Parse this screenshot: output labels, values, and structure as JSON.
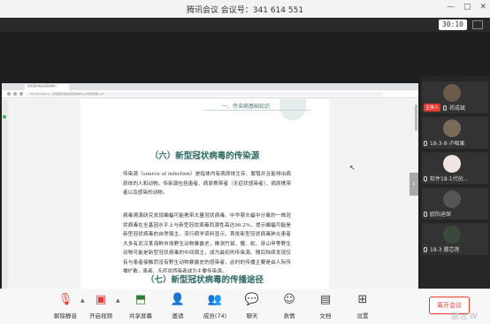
{
  "titlebar": {
    "title": "腾讯会议 会议号：341 614 551"
  },
  "status": {
    "timer": "30:10"
  },
  "browser": {
    "tab_label": "新型冠状病毒感染的肺炎",
    "url": "file:///C:/Users/.../新型冠状病毒感染的肺炎公众防护指南.pdf"
  },
  "document": {
    "page_header": "一、传染病基础知识",
    "section6_title": "（六）新型冠状病毒的传染源",
    "para1": "传染源（source of infection）是指体内有病原体生存、繁殖并且能排出病原体的人和动物。传染源包括患者、病原携带者（无症状感染者）、病原携带者以及感染的动物。",
    "para2": "病毒溯源研究发现蝙蝠可能携带大量冠状病毒。中华菊头蝠中分离的一株冠状病毒在全基因水平上与新型冠状病毒同源性高达96.2%，提示蝙蝠可能是新型冠状病毒的自然宿主。流行病学资料显示，首批新型冠状病毒肺炎患者大多有武汉某海鲜市场野生动物暴露史，推测竹鼠、獾、蛇、穿山甲等野生动物可能是新型冠状病毒的中间宿主，成为最初的传染源。随后陆续发现仅有与患者接触而没有野生动物暴露史的感染者，此时的传播主要是由人际传播扩散，患者、无症状感染者成为主要传染源。",
    "section7_title": "（七）新型冠状病毒的传播途径"
  },
  "participants": [
    {
      "name": "祁成斌",
      "host_badge": "主持人"
    },
    {
      "name": "18-3-9 卢昭果"
    },
    {
      "name": "软件18-1代创..."
    },
    {
      "name": "欧阳迪琛"
    },
    {
      "name": "18-3 滕芯莲"
    }
  ],
  "toolbar": {
    "mute": "解除静音",
    "video": "开启视频",
    "share": "共享屏幕",
    "invite": "邀请",
    "members": "成员(74)",
    "chat": "聊天",
    "reaction": "表情",
    "docs": "文档",
    "settings": "设置",
    "leave": "离开会议"
  },
  "watermark": "激活 W"
}
